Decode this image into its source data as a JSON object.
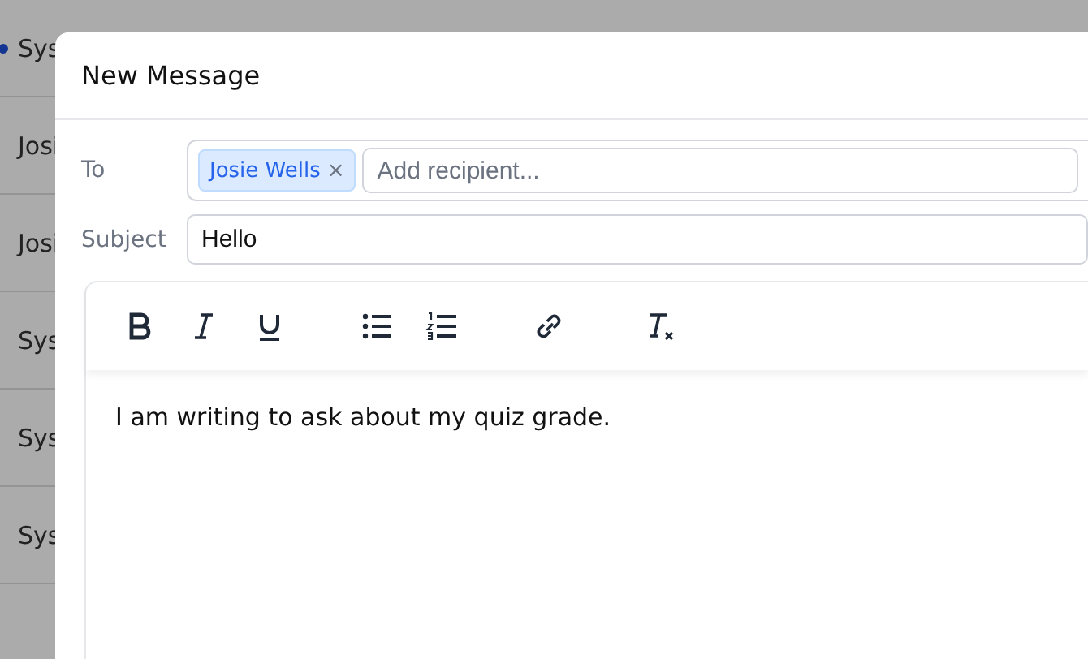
{
  "background_list": {
    "rows": [
      {
        "sender": "Sys",
        "unread": true
      },
      {
        "sender": "Josi",
        "unread": false
      },
      {
        "sender": "Josi",
        "unread": false
      },
      {
        "sender": "Sys",
        "unread": false
      },
      {
        "sender": "Sys",
        "unread": false
      },
      {
        "sender": "Sys",
        "unread": false
      }
    ]
  },
  "dialog": {
    "title": "New Message",
    "to_label": "To",
    "recipients": [
      {
        "name": "Josie Wells",
        "remove": "×"
      }
    ],
    "recipient_placeholder": "Add recipient...",
    "subject_label": "Subject",
    "subject": "Hello",
    "toolbar": [
      {
        "kind": "bold"
      },
      {
        "kind": "italic"
      },
      {
        "kind": "underline"
      },
      {
        "kind": "bullet-list"
      },
      {
        "kind": "numbered-list"
      },
      {
        "kind": "link"
      },
      {
        "kind": "clear-format"
      }
    ],
    "body": "I am writing to ask about my quiz grade."
  }
}
